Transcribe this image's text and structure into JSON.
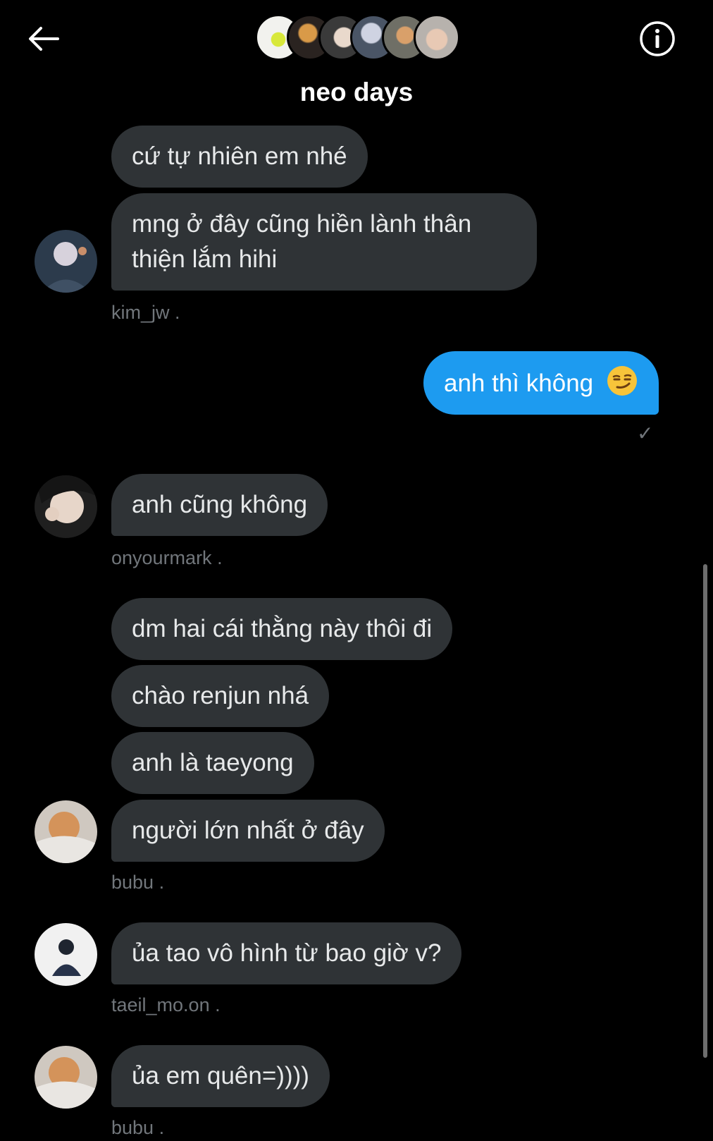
{
  "header": {
    "title": "neo days",
    "participant_count": 6
  },
  "messages": [
    {
      "text": "cứ tự nhiên em nhé"
    },
    {
      "text": "mng ở đây cũng hiền lành thân thiện lắm hihi"
    },
    {
      "sender": "kim_jw"
    },
    {
      "text": "anh thì không",
      "emoji": "smirking-face"
    },
    {
      "text": "anh cũng không"
    },
    {
      "sender": "onyourmark"
    },
    {
      "text": "dm hai cái thằng này thôi đi"
    },
    {
      "text": "chào renjun nhá"
    },
    {
      "text": "anh là taeyong"
    },
    {
      "text": "người lớn nhất ở đây"
    },
    {
      "sender": "bubu"
    },
    {
      "text": "ủa tao vô hình từ bao giờ v?"
    },
    {
      "sender": "taeil_mo.on"
    },
    {
      "text": "ủa em quên=))))"
    },
    {
      "sender": "bubu"
    }
  ],
  "meta_separator": ".",
  "read_receipt": "✓",
  "colors": {
    "background": "#000000",
    "incoming_bubble": "#2f3336",
    "outgoing_bubble": "#1d9bf0",
    "meta_text": "#71767b"
  }
}
